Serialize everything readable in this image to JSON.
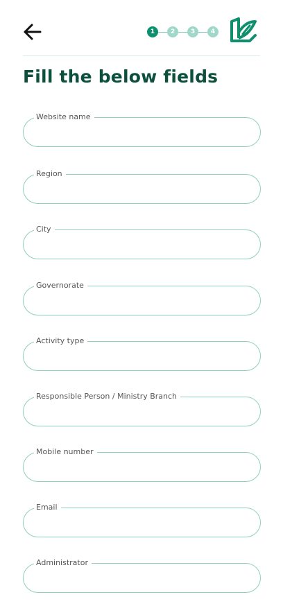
{
  "header": {
    "back_icon": "arrow-left-icon",
    "steps": [
      "1",
      "2",
      "3",
      "4"
    ],
    "active_step": 1,
    "logo_icon": "leaf-logo-icon",
    "accent_color": "#0e8f6e",
    "inactive_step_color": "#9fd8c8"
  },
  "page": {
    "title": "Fill the below fields",
    "title_color": "#0b4f3c"
  },
  "form": {
    "border_color": "#8fd0bd",
    "fields": [
      {
        "label": "Website name",
        "value": ""
      },
      {
        "label": "Region",
        "value": ""
      },
      {
        "label": "City",
        "value": ""
      },
      {
        "label": "Governorate",
        "value": ""
      },
      {
        "label": "Activity type",
        "value": ""
      },
      {
        "label": "Responsible Person / Ministry Branch",
        "value": ""
      },
      {
        "label": "Mobile number",
        "value": ""
      },
      {
        "label": "Email",
        "value": ""
      },
      {
        "label": "Administrator",
        "value": ""
      }
    ]
  }
}
